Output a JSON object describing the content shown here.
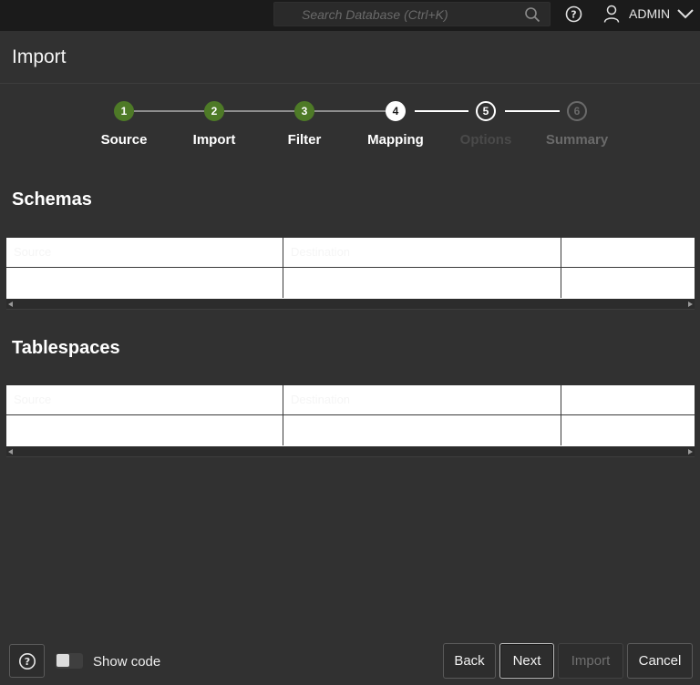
{
  "topbar": {
    "search_placeholder": "Search Database (Ctrl+K)",
    "user": "ADMIN"
  },
  "page": {
    "title": "Import"
  },
  "stepper": {
    "steps": [
      {
        "number": "1",
        "label": "Source",
        "state": "complete"
      },
      {
        "number": "2",
        "label": "Import",
        "state": "complete"
      },
      {
        "number": "3",
        "label": "Filter",
        "state": "complete"
      },
      {
        "number": "4",
        "label": "Mapping",
        "state": "current"
      },
      {
        "number": "5",
        "label": "Options",
        "state": "next"
      },
      {
        "number": "6",
        "label": "Summary",
        "state": "pending"
      }
    ]
  },
  "schemas": {
    "title": "Schemas",
    "columns": [
      "Source",
      "Destination",
      ""
    ]
  },
  "tablespaces": {
    "title": "Tablespaces",
    "columns": [
      "Source",
      "Destination",
      ""
    ]
  },
  "footer": {
    "show_code_label": "Show code",
    "back_label": "Back",
    "next_label": "Next",
    "import_label": "Import",
    "cancel_label": "Cancel"
  },
  "colors": {
    "complete": "#4e7a27",
    "background": "#313131",
    "topbar": "#1b1b1b"
  }
}
